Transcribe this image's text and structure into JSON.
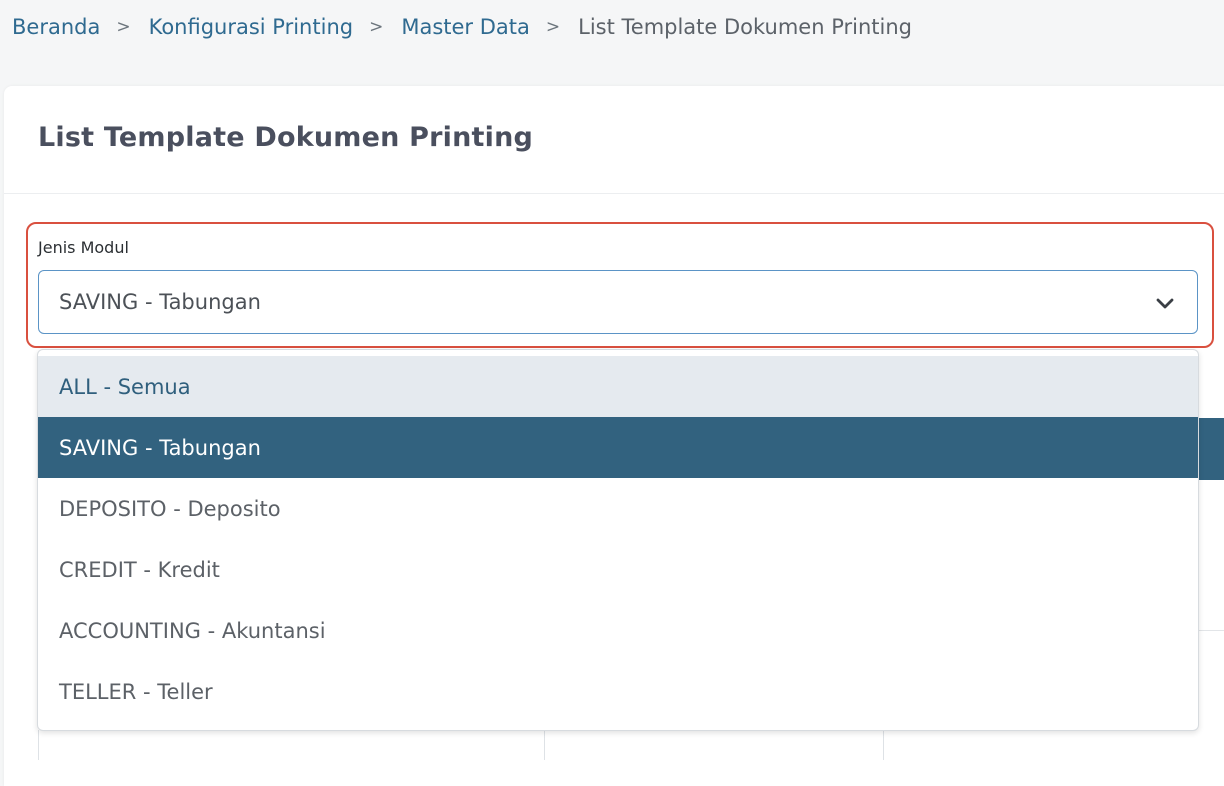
{
  "breadcrumb": {
    "items": [
      "Beranda",
      "Konfigurasi Printing",
      "Master Data"
    ],
    "current": "List Template Dokumen Printing",
    "separator": ">"
  },
  "card": {
    "title": "List Template Dokumen Printing"
  },
  "filter": {
    "label": "Jenis Modul",
    "selected_value": "SAVING - Tabungan",
    "icon": "chevron-down-icon",
    "options": [
      {
        "label": "ALL - Semua",
        "state": "hover"
      },
      {
        "label": "SAVING - Tabungan",
        "state": "selected"
      },
      {
        "label": "DEPOSITO - Deposito",
        "state": "normal"
      },
      {
        "label": "CREDIT - Kredit",
        "state": "normal"
      },
      {
        "label": "ACCOUNTING - Akuntansi",
        "state": "normal"
      },
      {
        "label": "TELLER - Teller",
        "state": "normal"
      }
    ]
  },
  "colors": {
    "link": "#2f6a90",
    "selected_option_bg": "#32627f",
    "hover_option_bg": "#e5eaef",
    "highlight_border": "#d9503f",
    "select_focus_border": "#5b94c6"
  }
}
